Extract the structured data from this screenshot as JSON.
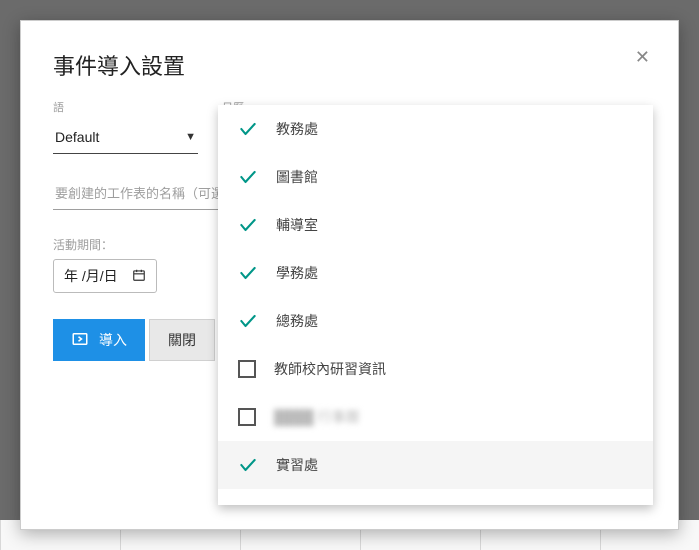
{
  "dialog": {
    "title": "事件導入設置"
  },
  "fields": {
    "language": {
      "label": "語",
      "value": "Default"
    },
    "calendar": {
      "label": "日曆"
    },
    "sheet": {
      "placeholder": "要創建的工作表的名稱（可選）"
    },
    "period": {
      "label": "活動期間：",
      "value": "年 /月/日"
    }
  },
  "buttons": {
    "import": "導入",
    "close": "關閉"
  },
  "calendar_options": [
    {
      "label": "教務處",
      "checked": true
    },
    {
      "label": "圖書館",
      "checked": true
    },
    {
      "label": "輔導室",
      "checked": true
    },
    {
      "label": "學務處",
      "checked": true
    },
    {
      "label": "總務處",
      "checked": true
    },
    {
      "label": "教師校內研習資訊",
      "checked": false
    },
    {
      "label": "████ 行事曆",
      "checked": false,
      "blurred": true
    },
    {
      "label": "實習處",
      "checked": true,
      "hover": true
    }
  ]
}
